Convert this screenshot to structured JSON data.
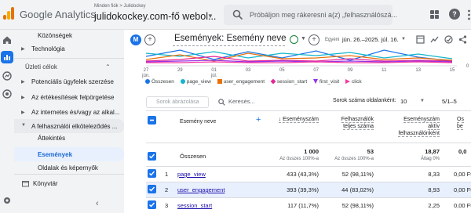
{
  "header": {
    "brand": "Google Analytics",
    "account_path": "Minden fiók > Julidockey",
    "account_name": "julidokockey.com-fő webol...",
    "search_placeholder": "Próbáljon meg rákeresni a(z) „felhasználószá..."
  },
  "sidebar": {
    "items": [
      {
        "label": "Közönségek",
        "indent": true
      },
      {
        "label": "Technológia",
        "expandable": true
      }
    ],
    "section_title": "Üzleti célok",
    "goal_items": [
      {
        "label": "Potenciális ügyfelek szerzése"
      },
      {
        "label": "Az értékesítések felpörgetése"
      },
      {
        "label": "Az internetes és/vagy az alkal..."
      },
      {
        "label": "A felhasználói elköteleződés ..."
      }
    ],
    "sub_items": [
      {
        "label": "Áttekintés"
      },
      {
        "label": "Események",
        "active": true
      },
      {
        "label": "Oldalak és képernyők"
      }
    ],
    "library_label": "Könyvtár"
  },
  "report": {
    "avatar_letter": "M",
    "title": "Események: Esemény neve",
    "date_label": "Egyéni",
    "date_value": "jún. 26.–2025. júl. 16."
  },
  "chart_data": {
    "type": "line",
    "x_ticks": [
      "27 jún.",
      "29",
      "01 júl.",
      "03",
      "05",
      "07",
      "09",
      "11",
      "13",
      "15"
    ],
    "y_tick_right": "0",
    "series": [
      {
        "name": "Összesen",
        "color": "#1a73e8"
      },
      {
        "name": "page_view",
        "color": "#12b5cb"
      },
      {
        "name": "user_engagement",
        "color": "#e8710a"
      },
      {
        "name": "session_start",
        "color": "#e52592"
      },
      {
        "name": "first_visit",
        "color": "#9334e6"
      },
      {
        "name": "click",
        "color": "#f538a0"
      }
    ]
  },
  "table": {
    "search_placeholder": "Sorok ábrázolása",
    "search_label": "Keresés...",
    "rows_per_page_label": "Sorok száma oldalanként:",
    "rows_per_page": "10",
    "pagination": "5/1–5",
    "columns": [
      {
        "label": "Esemény neve"
      },
      {
        "label": "↓ Eseményszám"
      },
      {
        "label": "Felhasználók teljes száma"
      },
      {
        "label": "Eseményszám aktív felhasználónként"
      },
      {
        "label": "Ös be"
      }
    ],
    "totals": {
      "label": "Összesen",
      "event_count": "1 000",
      "event_count_sub": "Az összes 100%-a",
      "users": "53",
      "users_sub": "Az összes 100%-a",
      "per_user": "18,87",
      "per_user_sub": "Átlag 0%",
      "revenue": "0,0"
    },
    "rows": [
      {
        "index": "1",
        "name": "page_view",
        "event_count": "433 (43,3%)",
        "users": "52 (98,11%)",
        "per_user": "8,33",
        "revenue": "0,00 Ft"
      },
      {
        "index": "2",
        "name": "user_engagement",
        "event_count": "393 (39,3%)",
        "users": "44 (83,02%)",
        "per_user": "8,93",
        "revenue": "0,00 Ft"
      },
      {
        "index": "3",
        "name": "session_start",
        "event_count": "117 (11,7%)",
        "users": "52 (98,11%)",
        "per_user": "2,25",
        "revenue": "0,00 Ft"
      }
    ]
  }
}
